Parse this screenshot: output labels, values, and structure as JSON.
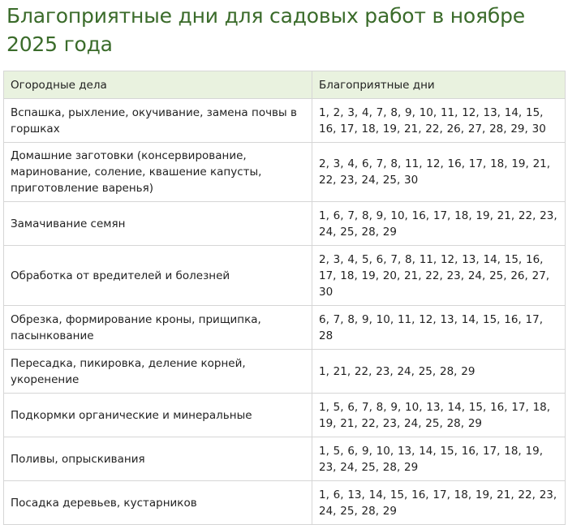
{
  "title": "Благоприятные дни для садовых работ в ноябре 2025 года",
  "table": {
    "headers": [
      "Огородные дела",
      "Благоприятные дни"
    ],
    "rows": [
      {
        "task": "Вспашка, рыхление, окучивание, замена почвы в горшках",
        "days": "1, 2, 3, 4, 7, 8, 9, 10, 11, 12, 13, 14, 15, 16, 17, 18, 19, 21, 22, 26, 27, 28, 29, 30"
      },
      {
        "task": "Домашние заготовки (консервирование, маринование, соление, квашение капусты, приготовление варенья)",
        "days": "2, 3, 4, 6, 7, 8, 11, 12, 16, 17, 18, 19, 21, 22, 23, 24, 25, 30"
      },
      {
        "task": "Замачивание семян",
        "days": "1, 6, 7, 8, 9, 10, 16, 17, 18, 19, 21, 22, 23, 24, 25, 28, 29"
      },
      {
        "task": "Обработка от вредителей и болезней",
        "days": "2, 3, 4, 5, 6, 7, 8, 11, 12, 13, 14, 15, 16, 17, 18, 19, 20, 21, 22, 23, 24, 25, 26, 27, 30"
      },
      {
        "task": "Обрезка, формирование кроны, прищипка, пасынкование",
        "days": "6, 7, 8, 9, 10, 11, 12, 13, 14, 15, 16, 17, 28"
      },
      {
        "task": "Пересадка, пикировка, деление корней, укоренение",
        "days": "1, 21, 22, 23, 24, 25, 28, 29"
      },
      {
        "task": "Подкормки органические и минеральные",
        "days": "1, 5, 6, 7, 8, 9, 10, 13, 14, 15, 16, 17, 18, 19, 21, 22, 23, 24, 25, 28, 29"
      },
      {
        "task": "Поливы, опрыскивания",
        "days": "1, 5, 6, 9, 10, 13, 14, 15, 16, 17, 18, 19, 23, 24, 25, 28, 29"
      },
      {
        "task": "Посадка деревьев, кустарников",
        "days": "1, 6, 13, 14, 15, 16, 17, 18, 19, 21, 22, 23, 24, 25, 28, 29"
      }
    ]
  }
}
